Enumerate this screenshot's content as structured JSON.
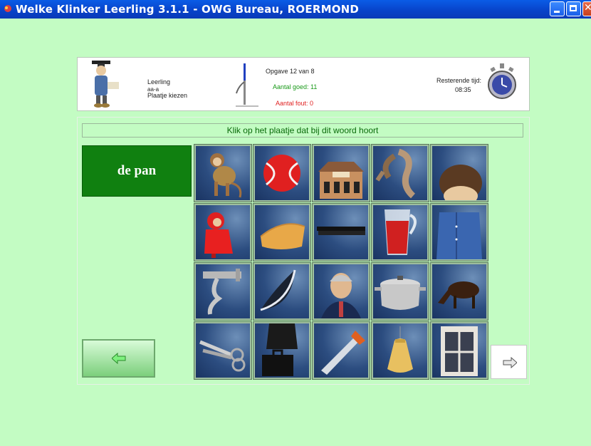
{
  "window": {
    "title": "Welke Klinker Leerling  3.1.1 - OWG Bureau, ROERMOND"
  },
  "header": {
    "leerling_label": "Leerling",
    "user": "aa-a",
    "mode": "Plaatje kiezen",
    "opgave": "Opgave 12 van 8",
    "aantal_goed": "Aantal goed: 11",
    "aantal_fout": "Aantal fout: 0",
    "resterende_label": "Resterende tijd:",
    "resterende_tijd": "08:35"
  },
  "main": {
    "instruction": "Klik op het plaatje dat bij dit woord hoort",
    "word": "de pan"
  },
  "tiles": [
    {
      "icon": "monkey-icon"
    },
    {
      "icon": "tennis-ball-icon"
    },
    {
      "icon": "house-icon"
    },
    {
      "icon": "scarf-icon"
    },
    {
      "icon": "hair-icon"
    },
    {
      "icon": "raincoat-child-icon"
    },
    {
      "icon": "cheese-icon"
    },
    {
      "icon": "comb-icon"
    },
    {
      "icon": "juice-pitcher-icon"
    },
    {
      "icon": "shirt-icon"
    },
    {
      "icon": "faucet-icon"
    },
    {
      "icon": "crescent-moon-icon"
    },
    {
      "icon": "man-face-icon"
    },
    {
      "icon": "cooking-pot-icon"
    },
    {
      "icon": "grazing-animal-icon"
    },
    {
      "icon": "scissors-icon"
    },
    {
      "icon": "briefcase-icon"
    },
    {
      "icon": "saw-icon"
    },
    {
      "icon": "sack-icon"
    },
    {
      "icon": "window-icon"
    }
  ],
  "colors": {
    "background": "#c3fcc3",
    "titlebar": "#0a5ce6",
    "word_box": "#108010",
    "goed": "#1a9a1a",
    "fout": "#e02020",
    "tile": "#2c4d80"
  }
}
